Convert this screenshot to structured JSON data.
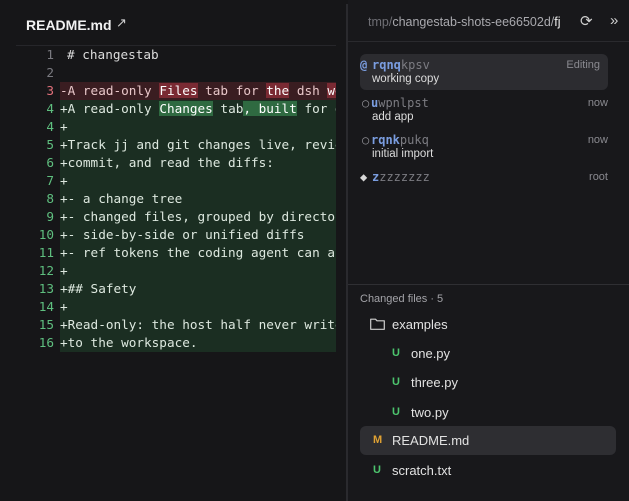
{
  "editor": {
    "file_title": "README.md",
    "open_icon": "external-link-icon",
    "lines": [
      {
        "n": "1",
        "kind": "ctx",
        "parts": [
          {
            "t": "# changestab"
          }
        ]
      },
      {
        "n": "2",
        "kind": "ctx",
        "parts": [
          {
            "t": ""
          }
        ]
      },
      {
        "n": "3",
        "kind": "del",
        "parts": [
          {
            "t": "-A read-only "
          },
          {
            "t": "Files",
            "hl": true
          },
          {
            "t": " tab for "
          },
          {
            "t": "the",
            "hl": true
          },
          {
            "t": " dsh "
          },
          {
            "t": "we",
            "hl": true
          }
        ]
      },
      {
        "n": "4",
        "kind": "add",
        "parts": [
          {
            "t": "+A read-only "
          },
          {
            "t": "Changes",
            "hl": true
          },
          {
            "t": " tab"
          },
          {
            "t": ", built",
            "hl": true
          },
          {
            "t": " for d"
          }
        ]
      },
      {
        "n": "4",
        "kind": "add",
        "parts": [
          {
            "t": "+"
          }
        ]
      },
      {
        "n": "5",
        "kind": "add",
        "parts": [
          {
            "t": "+Track jj and git changes live, revie"
          }
        ]
      },
      {
        "n": "6",
        "kind": "add",
        "parts": [
          {
            "t": "+commit, and read the diffs:"
          }
        ]
      },
      {
        "n": "7",
        "kind": "add",
        "parts": [
          {
            "t": "+"
          }
        ]
      },
      {
        "n": "8",
        "kind": "add",
        "parts": [
          {
            "t": "+- a change tree"
          }
        ]
      },
      {
        "n": "9",
        "kind": "add",
        "parts": [
          {
            "t": "+- changed files, grouped by director"
          }
        ]
      },
      {
        "n": "10",
        "kind": "add",
        "parts": [
          {
            "t": "+- side-by-side or unified diffs"
          }
        ]
      },
      {
        "n": "11",
        "kind": "add",
        "parts": [
          {
            "t": "+- ref tokens the coding agent can ac"
          }
        ]
      },
      {
        "n": "12",
        "kind": "add",
        "parts": [
          {
            "t": "+"
          }
        ]
      },
      {
        "n": "13",
        "kind": "add",
        "parts": [
          {
            "t": "+## Safety"
          }
        ]
      },
      {
        "n": "14",
        "kind": "add",
        "parts": [
          {
            "t": "+"
          }
        ]
      },
      {
        "n": "15",
        "kind": "add",
        "parts": [
          {
            "t": "+Read-only: the host half never write"
          }
        ]
      },
      {
        "n": "16",
        "kind": "add",
        "parts": [
          {
            "t": "+to the workspace."
          }
        ]
      }
    ]
  },
  "sidebar": {
    "path_dim": "tmp/",
    "path_mid": "changestab-shots-ee66502d/",
    "path_strong": "fj",
    "refresh_icon": "refresh-icon",
    "collapse_icon": "chevrons-right-icon",
    "commits": [
      {
        "symbol": "@",
        "id_prefix": "rqnq",
        "id_rest": "kpsv",
        "time": "Editing",
        "desc": "working copy",
        "selected": true
      },
      {
        "symbol": "○",
        "id_prefix": "u",
        "id_rest": "wpnlpst",
        "time": "now",
        "desc": "add app",
        "selected": false
      },
      {
        "symbol": "○",
        "id_prefix": "rqnk",
        "id_rest": "pukq",
        "time": "now",
        "desc": "initial import",
        "selected": false
      },
      {
        "symbol": "◆",
        "id_prefix": "z",
        "id_rest": "zzzzzzz",
        "time": "root",
        "desc": "",
        "selected": false
      }
    ],
    "files_label": "Changed files · 5",
    "files": [
      {
        "type": "folder",
        "name": "examples",
        "status": "",
        "indent": 0,
        "selected": false
      },
      {
        "type": "file",
        "name": "one.py",
        "status": "U",
        "indent": 1,
        "selected": false
      },
      {
        "type": "file",
        "name": "three.py",
        "status": "U",
        "indent": 1,
        "selected": false
      },
      {
        "type": "file",
        "name": "two.py",
        "status": "U",
        "indent": 1,
        "selected": false
      },
      {
        "type": "file",
        "name": "README.md",
        "status": "M",
        "indent": 0,
        "selected": true
      },
      {
        "type": "file",
        "name": "scratch.txt",
        "status": "U",
        "indent": 0,
        "selected": false
      }
    ]
  }
}
